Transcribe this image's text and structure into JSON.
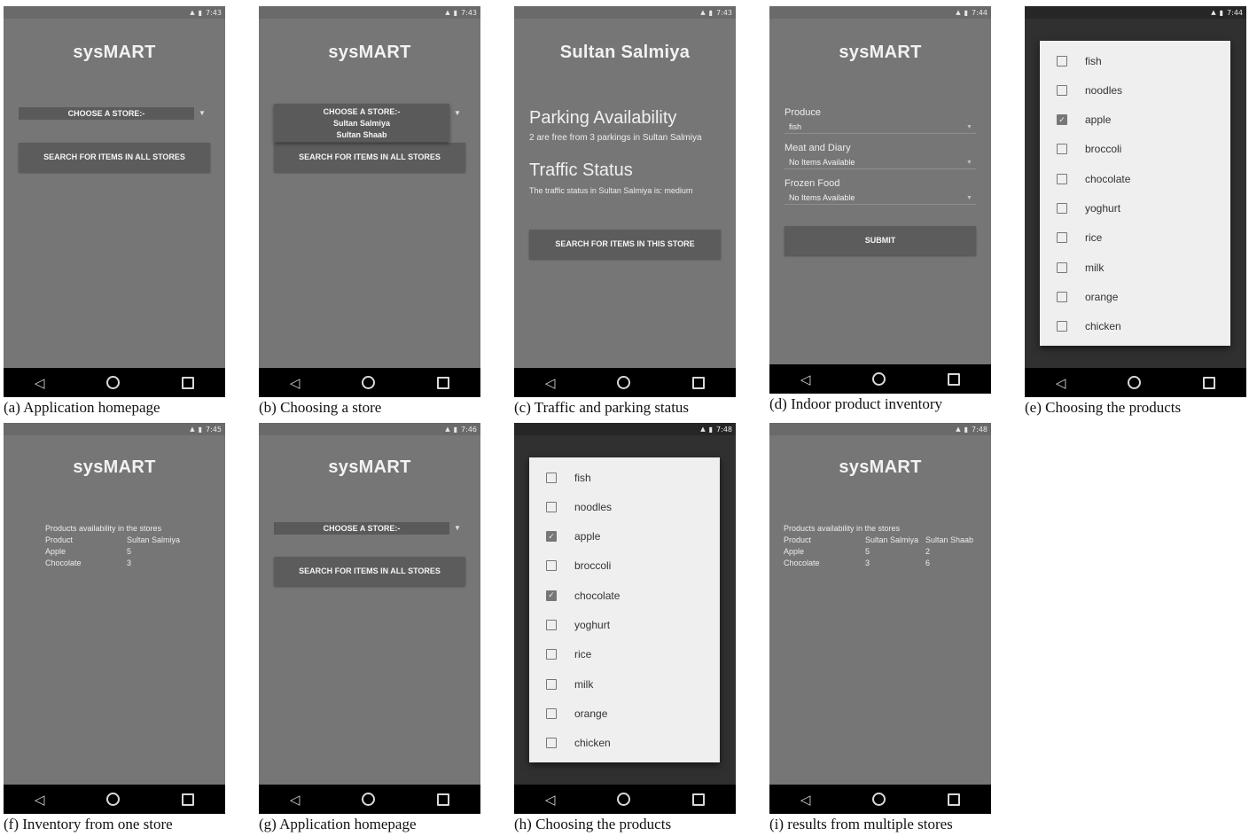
{
  "app": {
    "title": "sysMART",
    "choose_store": "CHOOSE A STORE:-",
    "search_all": "SEARCH FOR ITEMS IN ALL STORES",
    "search_this": "SEARCH FOR ITEMS IN THIS STORE",
    "submit": "SUBMIT",
    "stores": [
      "Sultan Salmiya",
      "Sultan Shaab"
    ]
  },
  "panels": {
    "a": {
      "time": "7:43",
      "caption": "(a)    Application homepage"
    },
    "b": {
      "time": "7:43",
      "caption": "(b) Choosing a store"
    },
    "c": {
      "time": "7:43",
      "caption": "(c) Traffic and parking status",
      "store_title": "Sultan Salmiya",
      "parking_heading": "Parking Availability",
      "parking_text": "2 are free from 3 parkings in Sultan Salmiya",
      "traffic_heading": "Traffic Status",
      "traffic_text": "The traffic status in Sultan Salmiya is: medium"
    },
    "d": {
      "time": "7:44",
      "caption": "(d) Indoor product inventory",
      "fields": [
        {
          "label": "Produce",
          "value": "fish"
        },
        {
          "label": "Meat and Diary",
          "value": "No Items Available"
        },
        {
          "label": "Frozen Food",
          "value": "No Items Available"
        }
      ]
    },
    "e": {
      "time": "7:44",
      "caption": "(e) Choosing the products"
    },
    "f": {
      "time": "7:45",
      "caption": "(f) Inventory from one store",
      "heading": "Products availability in the stores",
      "header": [
        "Product",
        "Sultan Salmiya"
      ],
      "rows": [
        [
          "Apple",
          "5"
        ],
        [
          "Chocolate",
          "3"
        ]
      ]
    },
    "g": {
      "time": "7:46",
      "caption": "(g) Application homepage"
    },
    "h": {
      "time": "7:48",
      "caption": "(h) Choosing the products"
    },
    "i": {
      "time": "7:48",
      "caption": "(i) results from multiple stores",
      "heading": "Products availability in the stores",
      "header": [
        "Product",
        "Sultan Salmiya",
        "Sultan Shaab"
      ],
      "rows": [
        [
          "Apple",
          "5",
          "2"
        ],
        [
          "Chocolate",
          "3",
          "6"
        ]
      ]
    }
  },
  "products": [
    "fish",
    "noodles",
    "apple",
    "broccoli",
    "chocolate",
    "yoghurt",
    "rice",
    "milk",
    "orange",
    "chicken"
  ],
  "checked_e": [
    "apple"
  ],
  "checked_h": [
    "apple",
    "chocolate"
  ],
  "icons": {
    "signal": "signal-icon",
    "battery": "battery-icon",
    "back": "back-icon",
    "home": "home-icon",
    "recents": "recents-icon"
  }
}
